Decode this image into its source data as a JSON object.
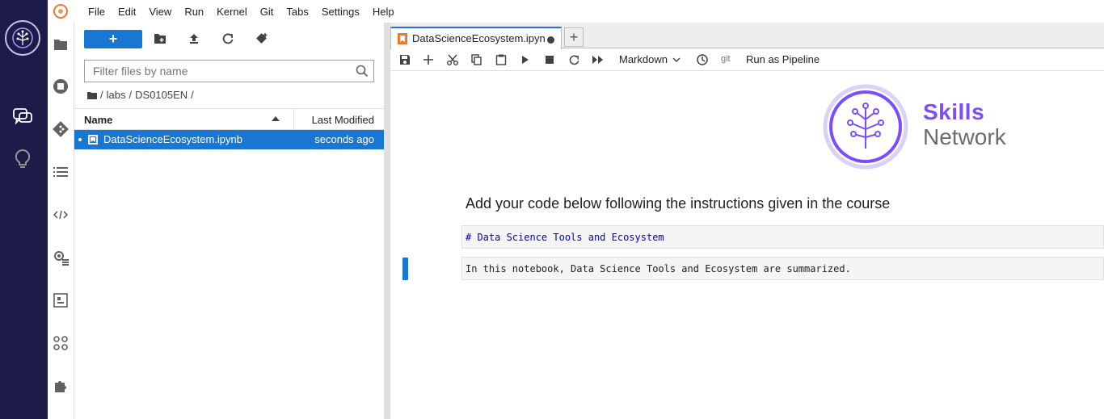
{
  "menubar": {
    "items": [
      "File",
      "Edit",
      "View",
      "Run",
      "Kernel",
      "Git",
      "Tabs",
      "Settings",
      "Help"
    ]
  },
  "filebrowser": {
    "new_label": "+",
    "filter_placeholder": "Filter files by name",
    "breadcrumb": [
      "/",
      "labs",
      "/",
      "DS0105EN",
      "/"
    ],
    "columns": {
      "name": "Name",
      "modified": "Last Modified"
    },
    "files": [
      {
        "name": "DataScienceEcosystem.ipynb",
        "modified": "seconds ago"
      }
    ]
  },
  "tabs": {
    "active_label": "DataScienceEcosystem.ipyn",
    "add_label": "+"
  },
  "nb_toolbar": {
    "cell_type": "Markdown",
    "git_label": "git",
    "pipeline_label": "Run as Pipeline"
  },
  "notebook": {
    "logo_line1": "Skills",
    "logo_line2": "Network",
    "heading": "Add your code below following the instructions given in the course",
    "cells": [
      "# Data Science Tools and Ecosystem",
      "In this notebook, Data Science Tools and Ecosystem are summarized."
    ]
  },
  "colors": {
    "rail": "#1e1b4b",
    "accent": "#1976d2",
    "brand_purple": "#7c4dff"
  }
}
